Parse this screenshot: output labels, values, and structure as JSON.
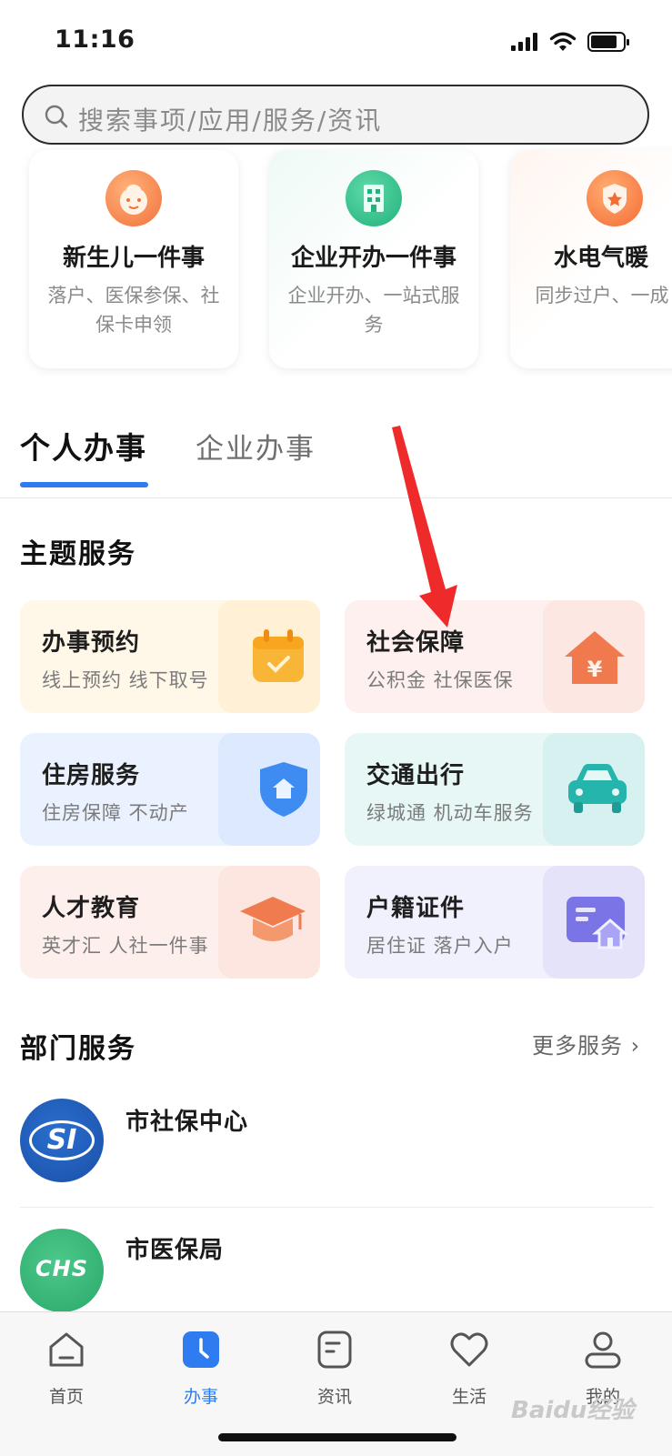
{
  "status_bar": {
    "time": "11:16"
  },
  "search": {
    "placeholder": "搜索事项/应用/服务/资讯"
  },
  "top_cards": [
    {
      "title": "新生儿一件事",
      "desc": "落户、医保参保、社保卡申领"
    },
    {
      "title": "企业开办一件事",
      "desc": "企业开办、一站式服务"
    },
    {
      "title": "水电气暖",
      "desc": "同步过户、一成"
    }
  ],
  "tabs": {
    "personal": "个人办事",
    "business": "企业办事"
  },
  "theme_section": {
    "title": "主题服务"
  },
  "services": [
    {
      "title": "办事预约",
      "desc": "线上预约 线下取号"
    },
    {
      "title": "社会保障",
      "desc": "公积金 社保医保"
    },
    {
      "title": "住房服务",
      "desc": "住房保障 不动产"
    },
    {
      "title": "交通出行",
      "desc": "绿城通 机动车服务"
    },
    {
      "title": "人才教育",
      "desc": "英才汇 人社一件事"
    },
    {
      "title": "户籍证件",
      "desc": "居住证 落户入户"
    }
  ],
  "dept_section": {
    "title": "部门服务",
    "more": "更多服务 ›"
  },
  "departments": [
    {
      "name": "市社保中心",
      "logo_text": "SI"
    },
    {
      "name": "市医保局",
      "logo_text": "CHS"
    }
  ],
  "nav": [
    {
      "label": "首页",
      "active": false
    },
    {
      "label": "办事",
      "active": true
    },
    {
      "label": "资讯",
      "active": false
    },
    {
      "label": "生活",
      "active": false
    },
    {
      "label": "我的",
      "active": false
    }
  ],
  "watermark": "Baidu经验",
  "colors": {
    "accent": "#2f7bf0",
    "arrow": "#ee2a2a"
  }
}
